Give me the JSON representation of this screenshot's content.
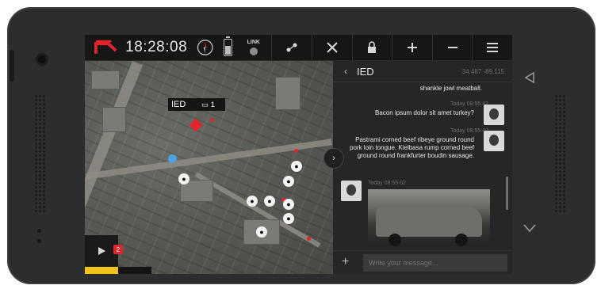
{
  "topbar": {
    "time": "18:28:08",
    "link_label": "LINK",
    "battery_level": 0.7,
    "actions": [
      {
        "icon": "route-icon",
        "glyph": "⟆"
      },
      {
        "icon": "tools-icon",
        "glyph": "✕"
      },
      {
        "icon": "lock-icon",
        "glyph": "🔒"
      },
      {
        "icon": "zoom-in-icon",
        "glyph": "+"
      },
      {
        "icon": "zoom-out-icon",
        "glyph": "−"
      },
      {
        "icon": "menu-icon",
        "glyph": "☰"
      }
    ]
  },
  "map": {
    "ied_label": "IED",
    "ied_count": "1",
    "ied_marker_count": "1",
    "play_count": "2",
    "markers_count": 9,
    "accent_red": "#e0262b",
    "accent_yellow": "#f2c318"
  },
  "chat": {
    "title": "IED",
    "coords": "34.487 -89.115",
    "messages": [
      {
        "text": "shankle jowl meatball.",
        "time": ""
      },
      {
        "text": "Bacon ipsum dolor sit amet turkey?",
        "time": "Today 08:55:42"
      },
      {
        "text": "Pastrami corned beef ribeye ground round pork loin tongue. Kielbasa rump corned beef ground round frankfurter boudin sausage.",
        "time": "Today 08:55:42"
      },
      {
        "text": "",
        "time": "Today 08:55:02"
      }
    ],
    "compose_placeholder": "Write your message..."
  }
}
